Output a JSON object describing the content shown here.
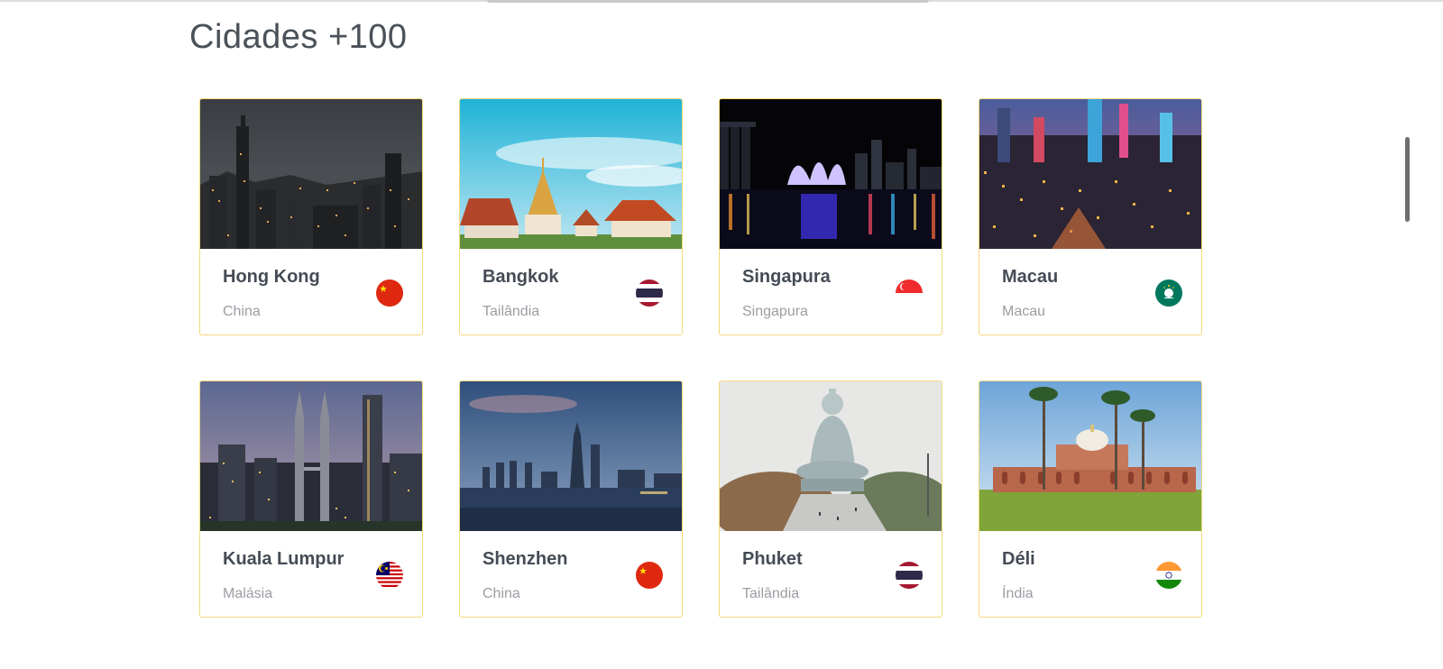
{
  "page": {
    "title": "Cidades +100"
  },
  "cities": [
    {
      "name": "Hong Kong",
      "country": "China",
      "flag_icon": "china-flag-icon",
      "photo_icon": "hong-kong-skyline-night-icon"
    },
    {
      "name": "Bangkok",
      "country": "Tailândia",
      "flag_icon": "thailand-flag-icon",
      "photo_icon": "bangkok-temple-icon"
    },
    {
      "name": "Singapura",
      "country": "Singapura",
      "flag_icon": "singapore-flag-icon",
      "photo_icon": "singapore-marina-night-icon"
    },
    {
      "name": "Macau",
      "country": "Macau",
      "flag_icon": "macau-flag-icon",
      "photo_icon": "macau-city-lights-icon"
    },
    {
      "name": "Kuala Lumpur",
      "country": "Malásia",
      "flag_icon": "malaysia-flag-icon",
      "photo_icon": "petronas-towers-icon"
    },
    {
      "name": "Shenzhen",
      "country": "China",
      "flag_icon": "china-flag-icon",
      "photo_icon": "shenzhen-bay-skyline-icon"
    },
    {
      "name": "Phuket",
      "country": "Tailândia",
      "flag_icon": "thailand-flag-icon",
      "photo_icon": "phuket-big-buddha-icon"
    },
    {
      "name": "Déli",
      "country": "Índia",
      "flag_icon": "india-flag-icon",
      "photo_icon": "humayun-tomb-icon"
    }
  ],
  "colors": {
    "card_border": "#f5d97a",
    "title_text": "#4a5159",
    "city_text": "#454c56",
    "country_text": "#9a9ea3"
  }
}
